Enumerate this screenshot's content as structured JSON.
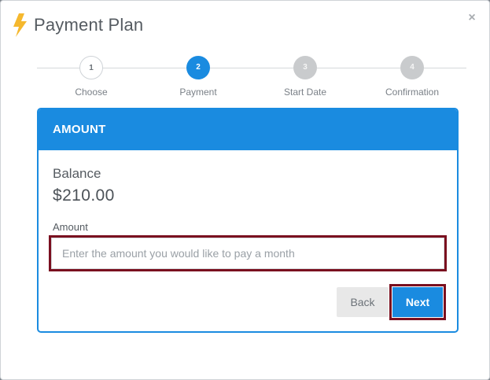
{
  "modal": {
    "title": "Payment Plan",
    "close_symbol": "×"
  },
  "steps": [
    {
      "number": "1",
      "label": "Choose",
      "state": "done"
    },
    {
      "number": "2",
      "label": "Payment",
      "state": "active"
    },
    {
      "number": "3",
      "label": "Start Date",
      "state": "todo"
    },
    {
      "number": "4",
      "label": "Confirmation",
      "state": "todo"
    }
  ],
  "card": {
    "header": "AMOUNT",
    "balance_label": "Balance",
    "balance_value": "$210.00",
    "amount_label": "Amount",
    "amount_value": "",
    "amount_placeholder": "Enter the amount you would like to pay a month"
  },
  "buttons": {
    "back": "Back",
    "next": "Next"
  },
  "icons": {
    "title_icon": "lightning-bolt-icon",
    "close_icon": "close-icon"
  },
  "colors": {
    "accent": "#1a8be0",
    "highlight_border": "#7a0f1f",
    "bolt": "#f5b82e"
  }
}
